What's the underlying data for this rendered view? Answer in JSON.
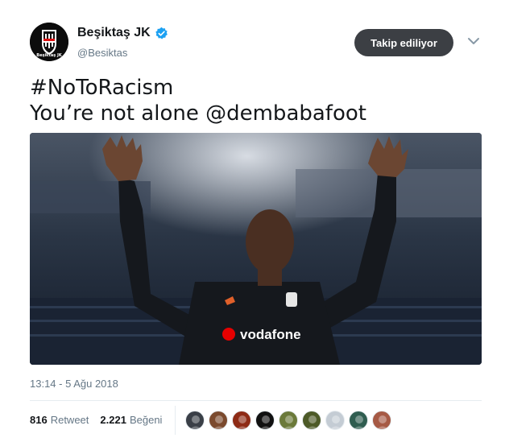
{
  "user": {
    "display_name": "Beşiktaş JK",
    "handle": "@Besiktas",
    "avatar_caption": "Beşiktaş JK",
    "verified": true
  },
  "follow_button_label": "Takip ediliyor",
  "tweet": {
    "line1": "#NoToRacism",
    "line2_prefix": "You’re not alone ",
    "mention": "@dembabafoot"
  },
  "media": {
    "shirt_sponsor": "vodafone"
  },
  "timestamp": "13:14 - 5 Ağu 2018",
  "stats": {
    "retweets_count": "816",
    "retweets_label": "Retweet",
    "likes_count": "2.221",
    "likes_label": "Beğeni"
  },
  "likers": [
    {
      "icon": "avatar-bw-icon",
      "color": "#3a3f47"
    },
    {
      "icon": "avatar-brown-icon",
      "color": "#7b4a2e"
    },
    {
      "icon": "avatar-red-icon",
      "color": "#8e2b16"
    },
    {
      "icon": "avatar-bjk-icon",
      "color": "#111111"
    },
    {
      "icon": "avatar-green-icon",
      "color": "#6b7a3a"
    },
    {
      "icon": "avatar-olive-icon",
      "color": "#4d5a28"
    },
    {
      "icon": "avatar-default-icon",
      "color": "#c4ccd4"
    },
    {
      "icon": "avatar-teal-icon",
      "color": "#2f5d50"
    },
    {
      "icon": "avatar-face-icon",
      "color": "#a65a45"
    }
  ],
  "colors": {
    "verified_blue": "#1da1f2",
    "follow_bg": "#3c3f44",
    "secondary_text": "#657786"
  }
}
